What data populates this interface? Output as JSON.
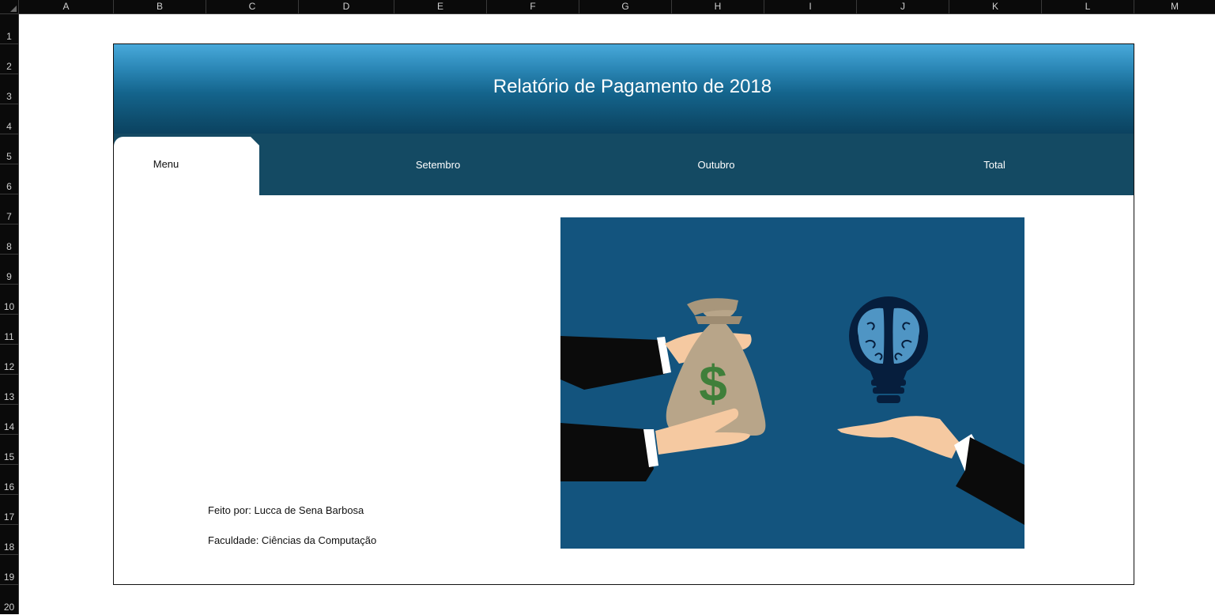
{
  "spreadsheet": {
    "columns": [
      "A",
      "B",
      "C",
      "D",
      "E",
      "F",
      "G",
      "H",
      "I",
      "J",
      "K",
      "L",
      "M"
    ],
    "rows": [
      "1",
      "2",
      "3",
      "4",
      "5",
      "6",
      "7",
      "8",
      "9",
      "10",
      "11",
      "12",
      "13",
      "14",
      "15",
      "16",
      "17",
      "18",
      "19",
      "20"
    ]
  },
  "dashboard": {
    "title": "Relatório de Pagamento de 2018",
    "tabs": [
      {
        "label": "Menu",
        "active": true
      },
      {
        "label": "Setembro",
        "active": false
      },
      {
        "label": "Outubro",
        "active": false
      },
      {
        "label": "Total",
        "active": false
      }
    ],
    "author_line": "Feito por: Lucca de Sena Barbosa",
    "faculty_line": "Faculdade: Ciências da Computação",
    "illustration": "money-bag-for-idea-lightbulb-exchange"
  },
  "colors": {
    "banner_top": "#48a9da",
    "banner_bottom": "#0b4260",
    "tab_bar": "#144a63",
    "illustration_bg": "#13547e",
    "brain": "#4f95c4",
    "dollar": "#3f7f3a"
  }
}
